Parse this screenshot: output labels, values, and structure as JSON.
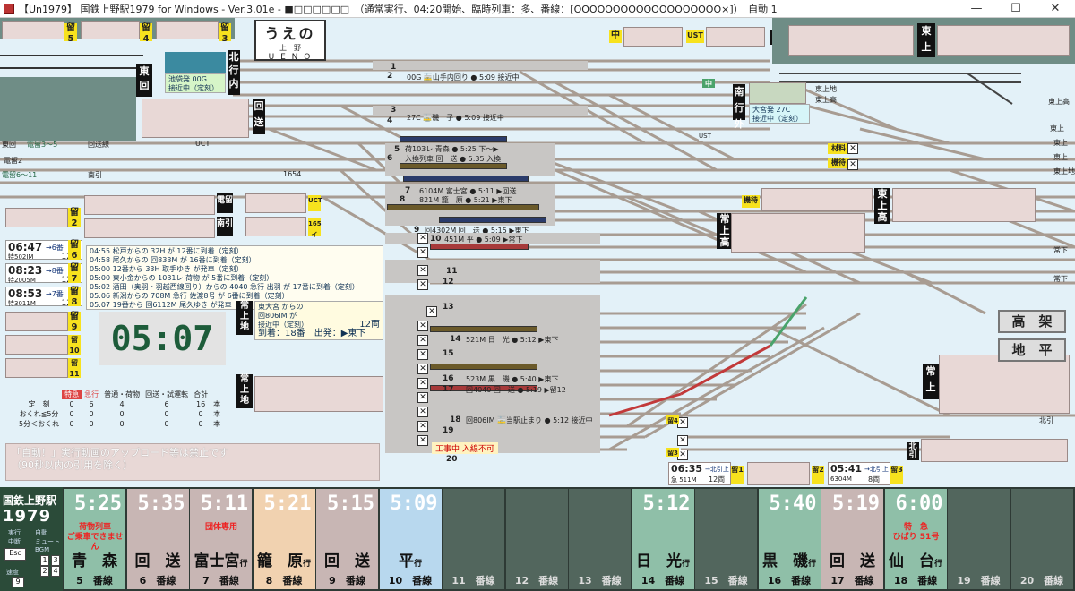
{
  "window": {
    "title": "【Un1979】 国鉄上野駅1979 for Windows - Ver.3.01e - ■□□□□□□　（通常実行、04:20開始、臨時列車：多、番線：[OOOOOOOOOOOOOOOOOOO×]）　自動 1",
    "min": "—",
    "max": "☐",
    "close": "✕"
  },
  "station_sign": {
    "kana": "うえの",
    "kanji": "上　野",
    "romaji": "U E N O"
  },
  "top_labels": {
    "ryu5": "留\n5",
    "ryu4": "留\n4",
    "ryu3": "留\n3",
    "chu": "中",
    "ust_top": "UST",
    "kai_top": "回",
    "tojo_top": "東上",
    "hokko_nai": "北行内",
    "higashi_kai": "東回",
    "kaiso": "回送",
    "nanko_gai": "南行外",
    "chu2": "中",
    "tojo_r": "東上",
    "jo_taka": "常上高",
    "tojo_taka": "東上高",
    "jo_chi": "常上地",
    "jo_chi2": "常上地",
    "jo_jo": "常上",
    "kitahiki": "北引",
    "higashi_chi": "東上地",
    "shunso": "材料",
    "kiso": "機待",
    "kiso2": "機待",
    "ryu2": "留\n2",
    "nanhiki": "南引",
    "ucti": "UCT",
    "165": "165イ",
    "ryu6": "留\n6",
    "ryu7": "留\n7",
    "ryu8": "留\n8",
    "ryu9": "留\n9",
    "ryu10": "留\n10",
    "ryu11": "留\n11",
    "denryu": "電留",
    "tosen": "東回",
    "ust": "UST",
    "uct": "UCT",
    "1654": "1654"
  },
  "track_labels": {
    "east": [
      "東回",
      "電留3〜5",
      "回送線",
      "電留2",
      "電留6〜11",
      "南引"
    ],
    "right": [
      "東上地",
      "東上高",
      "東上高",
      "東上",
      "東上",
      "東上",
      "常下",
      "常下",
      "北引"
    ]
  },
  "platform_texts": {
    "p1": "1",
    "p2": "2",
    "p2_info": "00G 🚋山手内回り ● 5:09 接近中",
    "p3": "3",
    "p4": "4",
    "p4_info": "27C 🚋磯　子 ● 5:09 接近中",
    "p5": "5",
    "p5_info": "荷103レ 青森 ● 5:25 下〜▶",
    "p6": "6",
    "p6_info": "入換列車 回　送 ● 5:35 入換",
    "p7": "7",
    "p7_info": "6104M 富士宮 ● 5:11 ▶回送",
    "p8": "8",
    "p8_info": "821M 籠　原 ● 5:21 ▶東下",
    "p9": "9",
    "p9_info": "回4302M 回　送 ● 5:15 ▶東下",
    "p10": "10",
    "p10_info": "451M 平 ● 5:09 ▶常下",
    "p11": "11",
    "p12": "12",
    "p13": "13",
    "p14": "14",
    "p14_info": "521M 日　光 ● 5:12 ▶東下",
    "p15": "15",
    "p16": "16",
    "p16_info": "523M 黒　磯 ● 5:40 ▶東下",
    "p17": "17",
    "p17_info": "回4040 回　送 ● 5:19 ▶留12",
    "p18": "18",
    "p18_info": "回806IM 🚋当駅止まり ● 5:12 接近中",
    "p19": "19",
    "p20": "20",
    "p20_warn": "工事中 入線不可"
  },
  "left_info": {
    "ikebukuro": "池袋発 00G",
    "ikebukuro2": "接近中（定刻）",
    "omiya": "大宮発 27C",
    "omiya2": "接近中（定刻）"
  },
  "dep_cards": [
    {
      "time": "06:47",
      "to": "→6番",
      "name": "特502IM",
      "cars": "12両"
    },
    {
      "time": "08:23",
      "to": "→8番",
      "name": "特2005M",
      "cars": "12両"
    },
    {
      "time": "08:53",
      "to": "→7番",
      "name": "特3011M",
      "cars": "12両"
    }
  ],
  "log": [
    "04:55 松戸からの 32H が 12番に到着（定刻）",
    "04:58 尾久からの 回833M が 16番に到着（定刻）",
    "05:00 12番から 33H 取手ゆき が発車（定刻）",
    "05:00 東小金からの 1031レ 荷物 が 5番に到着（定刻）",
    "05:02 酒田（奥羽・羽越西線回り）からの 4040 急行 出羽 が 17番に到着（定刻）",
    "05:06 新潟からの 708M 急行 佐渡8号 が 6番に到着（定刻）",
    "05:07 19番から 回6112M 尾久ゆき が発車（定刻）"
  ],
  "arrival_panel": {
    "from": "東大宮 からの",
    "train": "回806IM が",
    "status": "接近中（定刻）",
    "cars": "12両",
    "arrive_label": "到着：",
    "arrive_track": "18番",
    "dep_label": "出発：",
    "dep_dir": "▶東下"
  },
  "clock": "05:07",
  "buttons": {
    "koka": "高　架",
    "chihei": "地　平"
  },
  "stats": {
    "headers": [
      "",
      "特急",
      "急行",
      "普通・荷物",
      "回送・試運転",
      "合計",
      ""
    ],
    "rows": [
      [
        "定　刻",
        "0",
        "6",
        "4",
        "6",
        "16",
        "本"
      ],
      [
        "おくれ≦5分",
        "0",
        "0",
        "0",
        "0",
        "0",
        "本"
      ],
      [
        "5分＜おくれ",
        "0",
        "0",
        "0",
        "0",
        "0",
        "本"
      ]
    ]
  },
  "warning": {
    "line1": "「自動！」実行動画のアップロード等は禁止です",
    "line2": "（90秒以内の引用を除く）"
  },
  "bottom_right": {
    "card1_time": "06:35",
    "card1_to": "→北引上",
    "card1_name": "急 511M",
    "card1_cars": "12両",
    "card1_ryu": "留1",
    "ryu2": "留2",
    "card2_time": "05:41",
    "card2_to": "→北引上",
    "card2_name": "6304M",
    "card2_cars": "8両",
    "card2_ryu": "留3",
    "ryu4b": "留4",
    "ryu3b": "留3"
  },
  "board": {
    "logo1": "国鉄上野駅",
    "logo2": "1979",
    "ctrl": [
      "実行",
      "中断",
      "自動",
      "ミュート",
      "BGM",
      "速度"
    ],
    "keys": [
      "Esc",
      "1",
      "2",
      "3",
      "4",
      "9"
    ],
    "columns": [
      {
        "time": "5:25",
        "note": "荷物列車\nご乗車できません",
        "dest": "青　森",
        "suf": "",
        "track": "5　番線",
        "bg": "#8fbfa8"
      },
      {
        "time": "5:35",
        "note": "",
        "dest": "回　送",
        "suf": "",
        "track": "6　番線",
        "bg": "#c8b6b4"
      },
      {
        "time": "5:11",
        "note": "団体専用",
        "dest": "富士宮",
        "suf": "行",
        "track": "7　番線",
        "bg": "#c8b6b4"
      },
      {
        "time": "5:21",
        "note": "",
        "dest": "籠　原",
        "suf": "行",
        "track": "8　番線",
        "bg": "#f1d2b0"
      },
      {
        "time": "5:15",
        "note": "",
        "dest": "回　送",
        "suf": "",
        "track": "9　番線",
        "bg": "#c8b6b4"
      },
      {
        "time": "5:09",
        "note": "",
        "dest": "平",
        "suf": "行",
        "track": "10　番線",
        "bg": "#b8d8ee"
      },
      {
        "time": "",
        "note": "",
        "dest": "",
        "suf": "",
        "track": "11　番線",
        "bg": "#52665d"
      },
      {
        "time": "",
        "note": "",
        "dest": "",
        "suf": "",
        "track": "12　番線",
        "bg": "#52665d"
      },
      {
        "time": "",
        "note": "",
        "dest": "",
        "suf": "",
        "track": "13　番線",
        "bg": "#52665d"
      },
      {
        "time": "5:12",
        "note": "",
        "dest": "日　光",
        "suf": "行",
        "track": "14　番線",
        "bg": "#8fbfa8"
      },
      {
        "time": "",
        "note": "",
        "dest": "",
        "suf": "",
        "track": "15　番線",
        "bg": "#52665d"
      },
      {
        "time": "5:40",
        "note": "",
        "dest": "黒　磯",
        "suf": "行",
        "track": "16　番線",
        "bg": "#8fbfa8"
      },
      {
        "time": "5:19",
        "note": "",
        "dest": "回　送",
        "suf": "",
        "track": "17　番線",
        "bg": "#c8b6b4"
      },
      {
        "time": "6:00",
        "note": "特　急\nひばり 51号",
        "dest": "仙　台",
        "suf": "行",
        "track": "18　番線",
        "bg": "#8fbfa8"
      },
      {
        "time": "",
        "note": "",
        "dest": "",
        "suf": "",
        "track": "19　番線",
        "bg": "#52665d"
      },
      {
        "time": "",
        "note": "",
        "dest": "",
        "suf": "",
        "track": "20　番線",
        "bg": "#52665d"
      }
    ]
  }
}
